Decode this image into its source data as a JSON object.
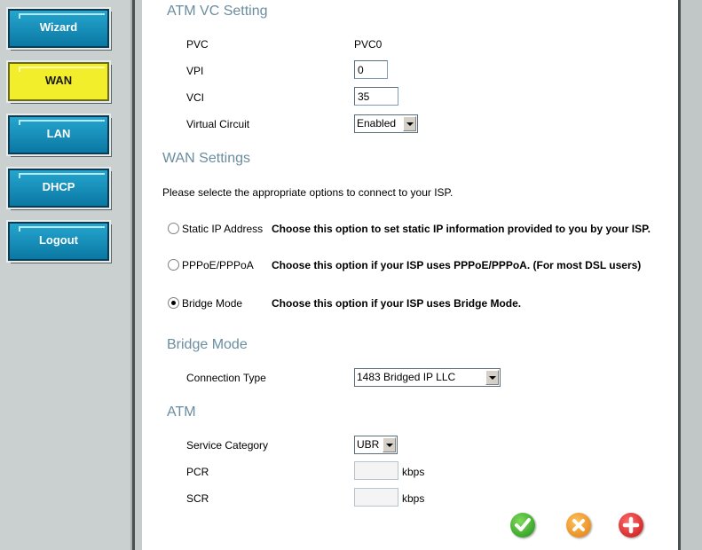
{
  "sidebar": {
    "items": [
      {
        "label": "Wizard"
      },
      {
        "label": "WAN"
      },
      {
        "label": "LAN"
      },
      {
        "label": "DHCP"
      },
      {
        "label": "Logout"
      }
    ],
    "active": "WAN"
  },
  "atm_vc": {
    "title": "ATM VC Setting",
    "pvc_label": "PVC",
    "pvc_value": "PVC0",
    "vpi_label": "VPI",
    "vpi_value": "0",
    "vci_label": "VCI",
    "vci_value": "35",
    "vc_label": "Virtual Circuit",
    "vc_value": "Enabled"
  },
  "wan": {
    "title": "WAN Settings",
    "intro": "Please selecte the appropriate options to connect to your ISP.",
    "options": [
      {
        "label": "Static IP Address",
        "desc": "Choose this option to set static IP information provided to you by your ISP.",
        "checked": false
      },
      {
        "label": "PPPoE/PPPoA",
        "desc": "Choose this option if your ISP uses PPPoE/PPPoA. (For most DSL users)",
        "checked": false
      },
      {
        "label": "Bridge Mode",
        "desc": "Choose this option if your ISP uses Bridge Mode.",
        "checked": true
      }
    ]
  },
  "bridge": {
    "title": "Bridge Mode",
    "conn_label": "Connection Type",
    "conn_value": "1483 Bridged IP LLC"
  },
  "atm": {
    "title": "ATM",
    "service_label": "Service Category",
    "service_value": "UBR",
    "pcr_label": "PCR",
    "pcr_value": "",
    "scr_label": "SCR",
    "scr_value": "",
    "unit": "kbps"
  },
  "actions": {
    "apply_icon": "check-circle-icon",
    "cancel_icon": "x-circle-icon",
    "help_icon": "plus-circle-icon"
  },
  "colors": {
    "section_title": "#6a8da0",
    "nav_button": "#1a8fbb",
    "nav_active": "#f3ee2b"
  }
}
